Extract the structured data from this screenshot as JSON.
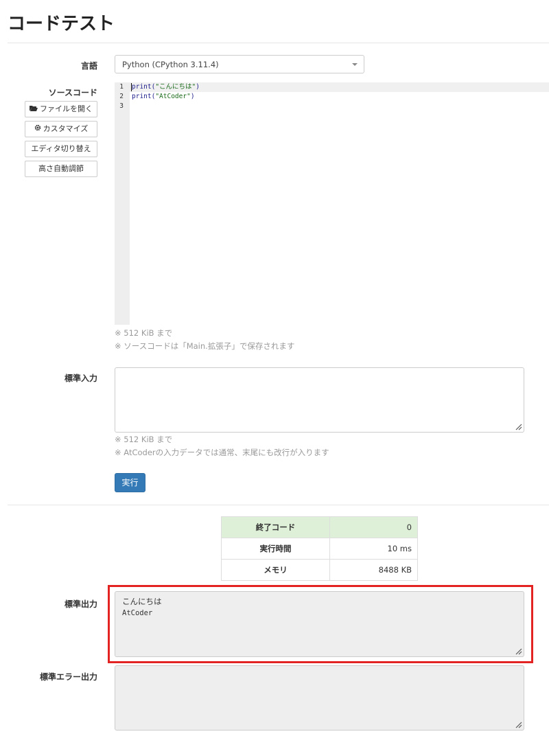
{
  "page": {
    "title": "コードテスト"
  },
  "language": {
    "label": "言語",
    "selected": "Python (CPython 3.11.4)"
  },
  "source": {
    "label": "ソースコード",
    "buttons": [
      {
        "label": "ファイルを開く",
        "icon": "folder-open-icon"
      },
      {
        "label": "カスタマイズ",
        "icon": "gear-icon"
      },
      {
        "label": "エディタ切り替え"
      },
      {
        "label": "高さ自動調節"
      }
    ],
    "lines": [
      {
        "num": "1",
        "fn": "print(",
        "str": "\"こんにちは\"",
        "end": ")"
      },
      {
        "num": "2",
        "fn": "print(",
        "str": "\"AtCoder\"",
        "end": ")"
      },
      {
        "num": "3",
        "fn": "",
        "str": "",
        "end": ""
      }
    ],
    "notes": [
      "※ 512 KiB まで",
      "※ ソースコードは「Main.拡張子」で保存されます"
    ]
  },
  "stdin": {
    "label": "標準入力",
    "value": "",
    "notes": [
      "※ 512 KiB まで",
      "※ AtCoderの入力データでは通常、末尾にも改行が入ります"
    ]
  },
  "run_button": "実行",
  "results": [
    {
      "key": "終了コード",
      "value": "0",
      "status": "ok"
    },
    {
      "key": "実行時間",
      "value": "10 ms"
    },
    {
      "key": "メモリ",
      "value": "8488 KB"
    }
  ],
  "stdout": {
    "label": "標準出力",
    "line1": "こんにちは",
    "line2": "AtCoder"
  },
  "stderr": {
    "label": "標準エラー出力",
    "value": ""
  },
  "colors": {
    "primary": "#337ab7",
    "success_bg": "#dff0d8",
    "highlight": "#e32222"
  }
}
